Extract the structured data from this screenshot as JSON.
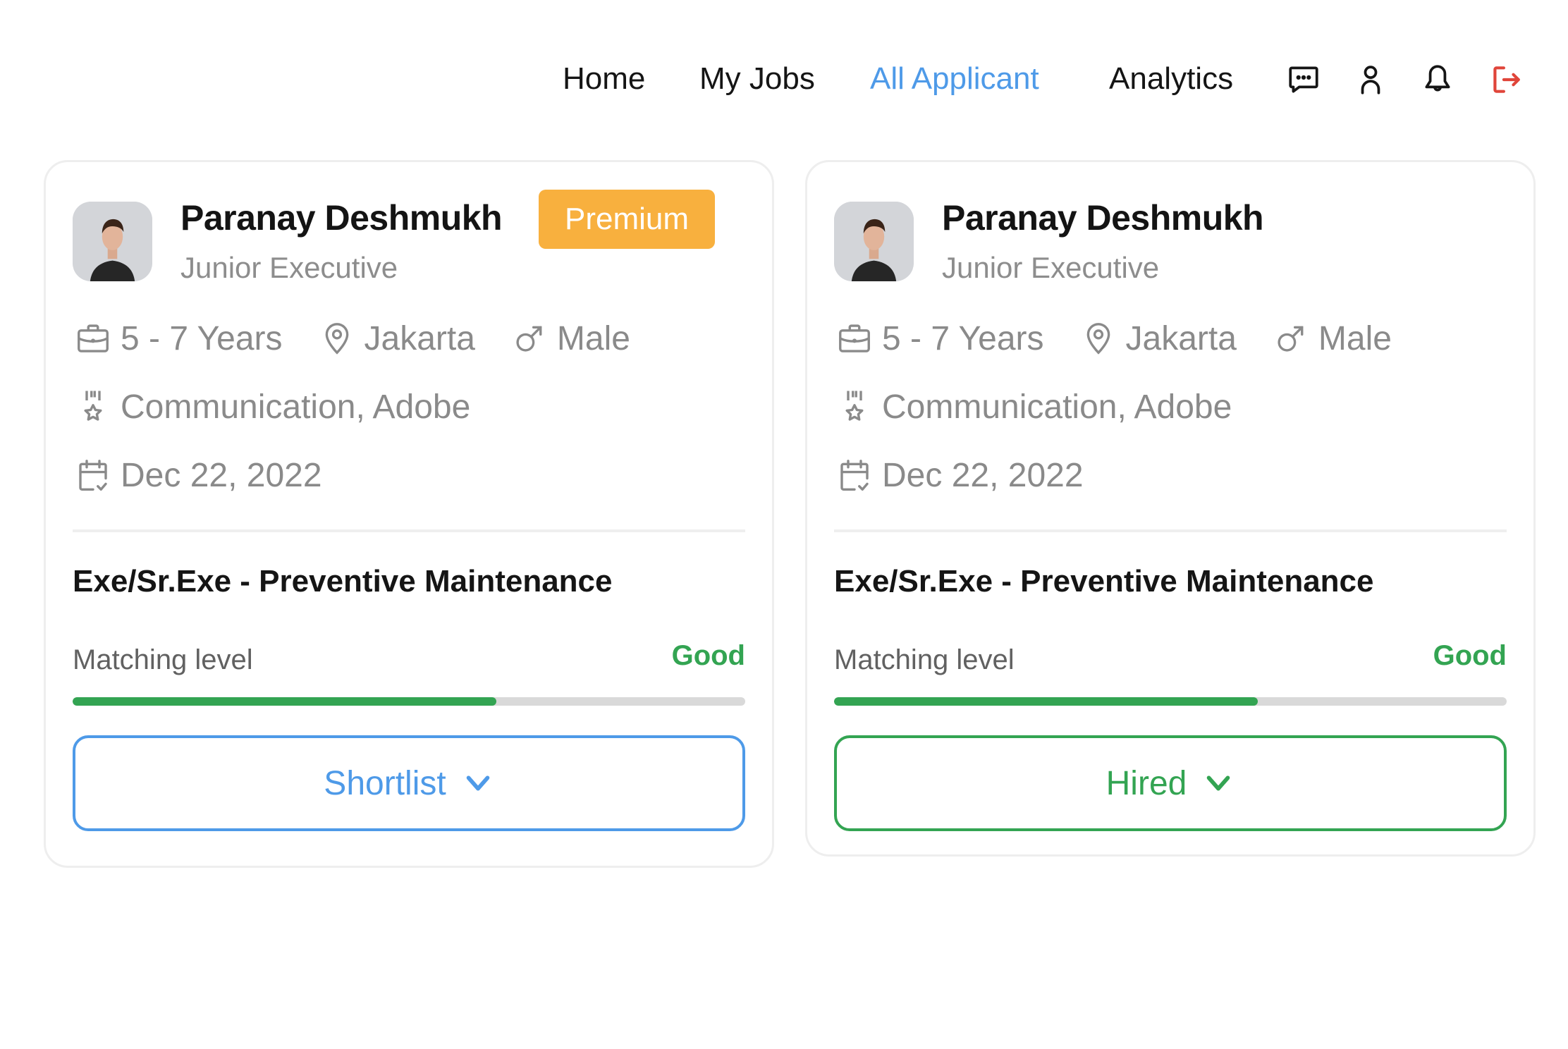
{
  "nav": {
    "links": [
      {
        "label": "Home",
        "active": false
      },
      {
        "label": "My Jobs",
        "active": false
      },
      {
        "label": "All Applicant",
        "active": true
      },
      {
        "label": "Analytics",
        "active": false
      }
    ],
    "icons": [
      "chat-icon",
      "user-icon",
      "bell-icon",
      "logout-icon"
    ]
  },
  "colors": {
    "accent_blue": "#4e9ae8",
    "premium_orange": "#f8b03e",
    "good_green": "#33a452",
    "logout_red": "#e0453a"
  },
  "applicants": [
    {
      "name": "Paranay Deshmukh",
      "badge": "Premium",
      "role": "Junior Executive",
      "experience": "5 - 7 Years",
      "location": "Jakarta",
      "gender": "Male",
      "skills": "Communication, Adobe",
      "date": "Dec 22, 2022",
      "job_title": "Exe/Sr.Exe - Preventive Maintenance",
      "matching_label": "Matching level",
      "matching_value": "Good",
      "matching_percent": 63,
      "status": "Shortlist"
    },
    {
      "name": "Paranay Deshmukh",
      "badge": null,
      "role": "Junior Executive",
      "experience": "5 - 7 Years",
      "location": "Jakarta",
      "gender": "Male",
      "skills": "Communication, Adobe",
      "date": "Dec 22, 2022",
      "job_title": "Exe/Sr.Exe - Preventive Maintenance",
      "matching_label": "Matching level",
      "matching_value": "Good",
      "matching_percent": 63,
      "status": "Hired"
    }
  ]
}
